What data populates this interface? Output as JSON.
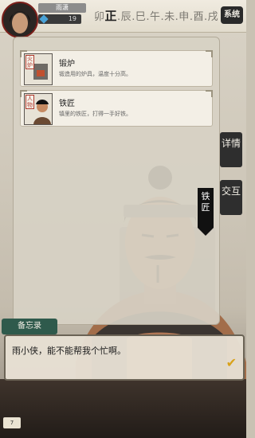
{
  "header": {
    "player_name": "雨潇",
    "level": "19",
    "hours": [
      "卯",
      "正",
      "辰",
      "巳",
      "午",
      "未",
      "申",
      "酉",
      "戌"
    ],
    "current_hour_index": 1,
    "system_label": "系统"
  },
  "location_cards": [
    {
      "tag": "火炉",
      "title": "锻炉",
      "desc": "锻造用的炉具，温度十分高。"
    },
    {
      "tag": "人物",
      "title": "铁匠",
      "desc": "镇里的铁匠，打得一手好铁。"
    }
  ],
  "side_tabs": {
    "detail": "详情",
    "interact": "交互"
  },
  "npc_name": "铁匠",
  "memo_label": "备忘录",
  "dialog": {
    "text": "雨小侠，能不能帮我个忙啊。"
  },
  "bottom": {
    "count": "7"
  },
  "colors": {
    "accent_red": "#7a1f1a",
    "accent_gold": "#d9a21a",
    "memo_green": "#2f5a4c"
  }
}
